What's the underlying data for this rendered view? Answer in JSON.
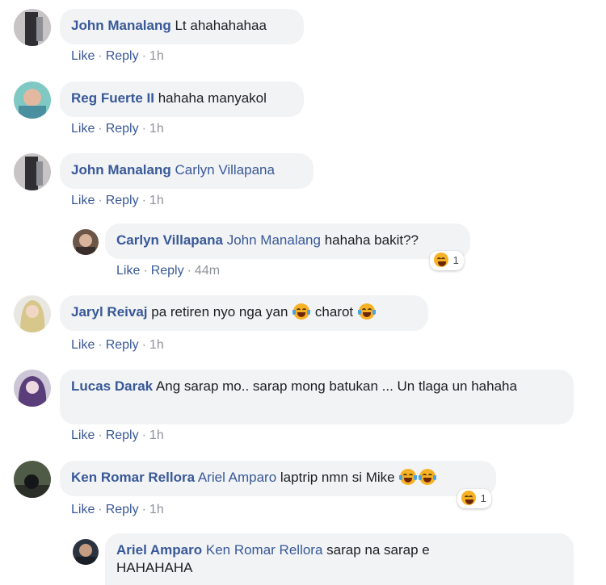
{
  "comments": [
    {
      "author": "John Manalang",
      "text": "Lt ahahahahaa",
      "like": "Like",
      "reply": "Reply",
      "time": "1h"
    },
    {
      "author": "Reg Fuerte II",
      "text": "hahaha manyakol",
      "like": "Like",
      "reply": "Reply",
      "time": "1h"
    },
    {
      "author": "John Manalang",
      "mention": "Carlyn Villapana",
      "like": "Like",
      "reply": "Reply",
      "time": "1h"
    },
    {
      "author": "Carlyn Villapana",
      "mention": "John Manalang",
      "text": "hahaha bakit??",
      "like": "Like",
      "reply": "Reply",
      "time": "44m",
      "reaction_count": "1"
    },
    {
      "author": "Jaryl Reivaj",
      "text_a": "pa retiren nyo nga yan",
      "text_b": "charot",
      "like": "Like",
      "reply": "Reply",
      "time": "1h"
    },
    {
      "author": "Lucas Darak",
      "text": "Ang sarap mo.. sarap mong batukan ... Un tlaga un hahaha",
      "like": "Like",
      "reply": "Reply",
      "time": "1h"
    },
    {
      "author": "Ken Romar Rellora",
      "mention": "Ariel Amparo",
      "text": "laptrip nmn si Mike",
      "like": "Like",
      "reply": "Reply",
      "time": "1h",
      "reaction_count": "1"
    },
    {
      "author": "Ariel Amparo",
      "mention": "Ken Romar Rellora",
      "text": "sarap na sarap e HAHAHAHA"
    }
  ],
  "icons": {
    "reaction": "laughing-emoji-icon"
  },
  "colors": {
    "link": "#385898",
    "bubble": "#f2f3f5",
    "meta": "#90949c"
  }
}
